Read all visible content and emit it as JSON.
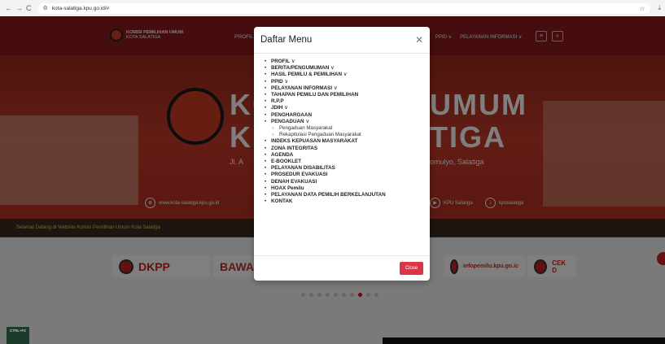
{
  "browser": {
    "url": "kota-salatiga.kpu.go.id/#",
    "profile_initial": "P"
  },
  "site": {
    "brand_line1": "KOMISI PEMILIHAN UMUM",
    "brand_line2": "KOTA SALATIGA",
    "nav_left": "PROFIL",
    "nav_right": [
      "PPID ∨",
      "PELAYANAN INFORMASI ∨"
    ],
    "hero_left": "KO",
    "hero_left2": "K",
    "hero_right": "UMUM",
    "hero_right2": "TIGA",
    "hero_sub_left": "Jl. A",
    "hero_sub_right": "omulyo, Salatiga",
    "website": "www.kota-salatiga.kpu.go.id",
    "youtube": "KPU Salatiga",
    "tiktok": "kpusalatiga",
    "ticker": "Selamat Datang di Website Komisi Pemilihan Umum Kota Salatiga",
    "banners": [
      "DKPP",
      "BAWA",
      "infopemilu.kpu.go.ic",
      "CEK D"
    ],
    "ctrl_badge": "CTRL+F2"
  },
  "modal": {
    "title": "Daftar Menu",
    "close_label": "Close",
    "items": [
      {
        "label": "PROFIL",
        "chevron": " ∨"
      },
      {
        "label": "BERITA/PENGUMUMAN",
        "chevron": " ∨"
      },
      {
        "label": "HASIL PEMILU & PEMILIHAN",
        "chevron": " ∨"
      },
      {
        "label": "PPID",
        "chevron": " ∨"
      },
      {
        "label": "PELAYANAN INFORMASI",
        "chevron": " ∨"
      },
      {
        "label": "TAHAPAN PEMILU DAN PEMILIHAN",
        "chevron": ""
      },
      {
        "label": "R.P.P",
        "chevron": ""
      },
      {
        "label": "JDIH",
        "chevron": " ∨"
      },
      {
        "label": "PENGHARGAAN",
        "chevron": ""
      },
      {
        "label": "PENGADUAN",
        "chevron": " ∨",
        "sub": [
          "Pengaduan Masyarakat",
          "Rekapitulasi Pengaduan Masyarakat"
        ]
      },
      {
        "label": "INDEKS KEPUASAN MASYARAKAT",
        "chevron": ""
      },
      {
        "label": "ZONA INTEGRITAS",
        "chevron": ""
      },
      {
        "label": "AGENDA",
        "chevron": ""
      },
      {
        "label": "E-BOOKLET",
        "chevron": ""
      },
      {
        "label": "PELAYANAN DISABILITAS",
        "chevron": ""
      },
      {
        "label": "PROSEDUR EVAKUASI",
        "chevron": ""
      },
      {
        "label": "DENAH EVAKUASI",
        "chevron": ""
      },
      {
        "label": "HOAX Pemilu",
        "chevron": ""
      },
      {
        "label": "PELAYANAN DATA PEMILIH BERKELANJUTAN",
        "chevron": ""
      },
      {
        "label": "KONTAK",
        "chevron": ""
      }
    ]
  },
  "colors": {
    "nav_bg": "#8a1a1a",
    "close_btn": "#dc3545"
  }
}
